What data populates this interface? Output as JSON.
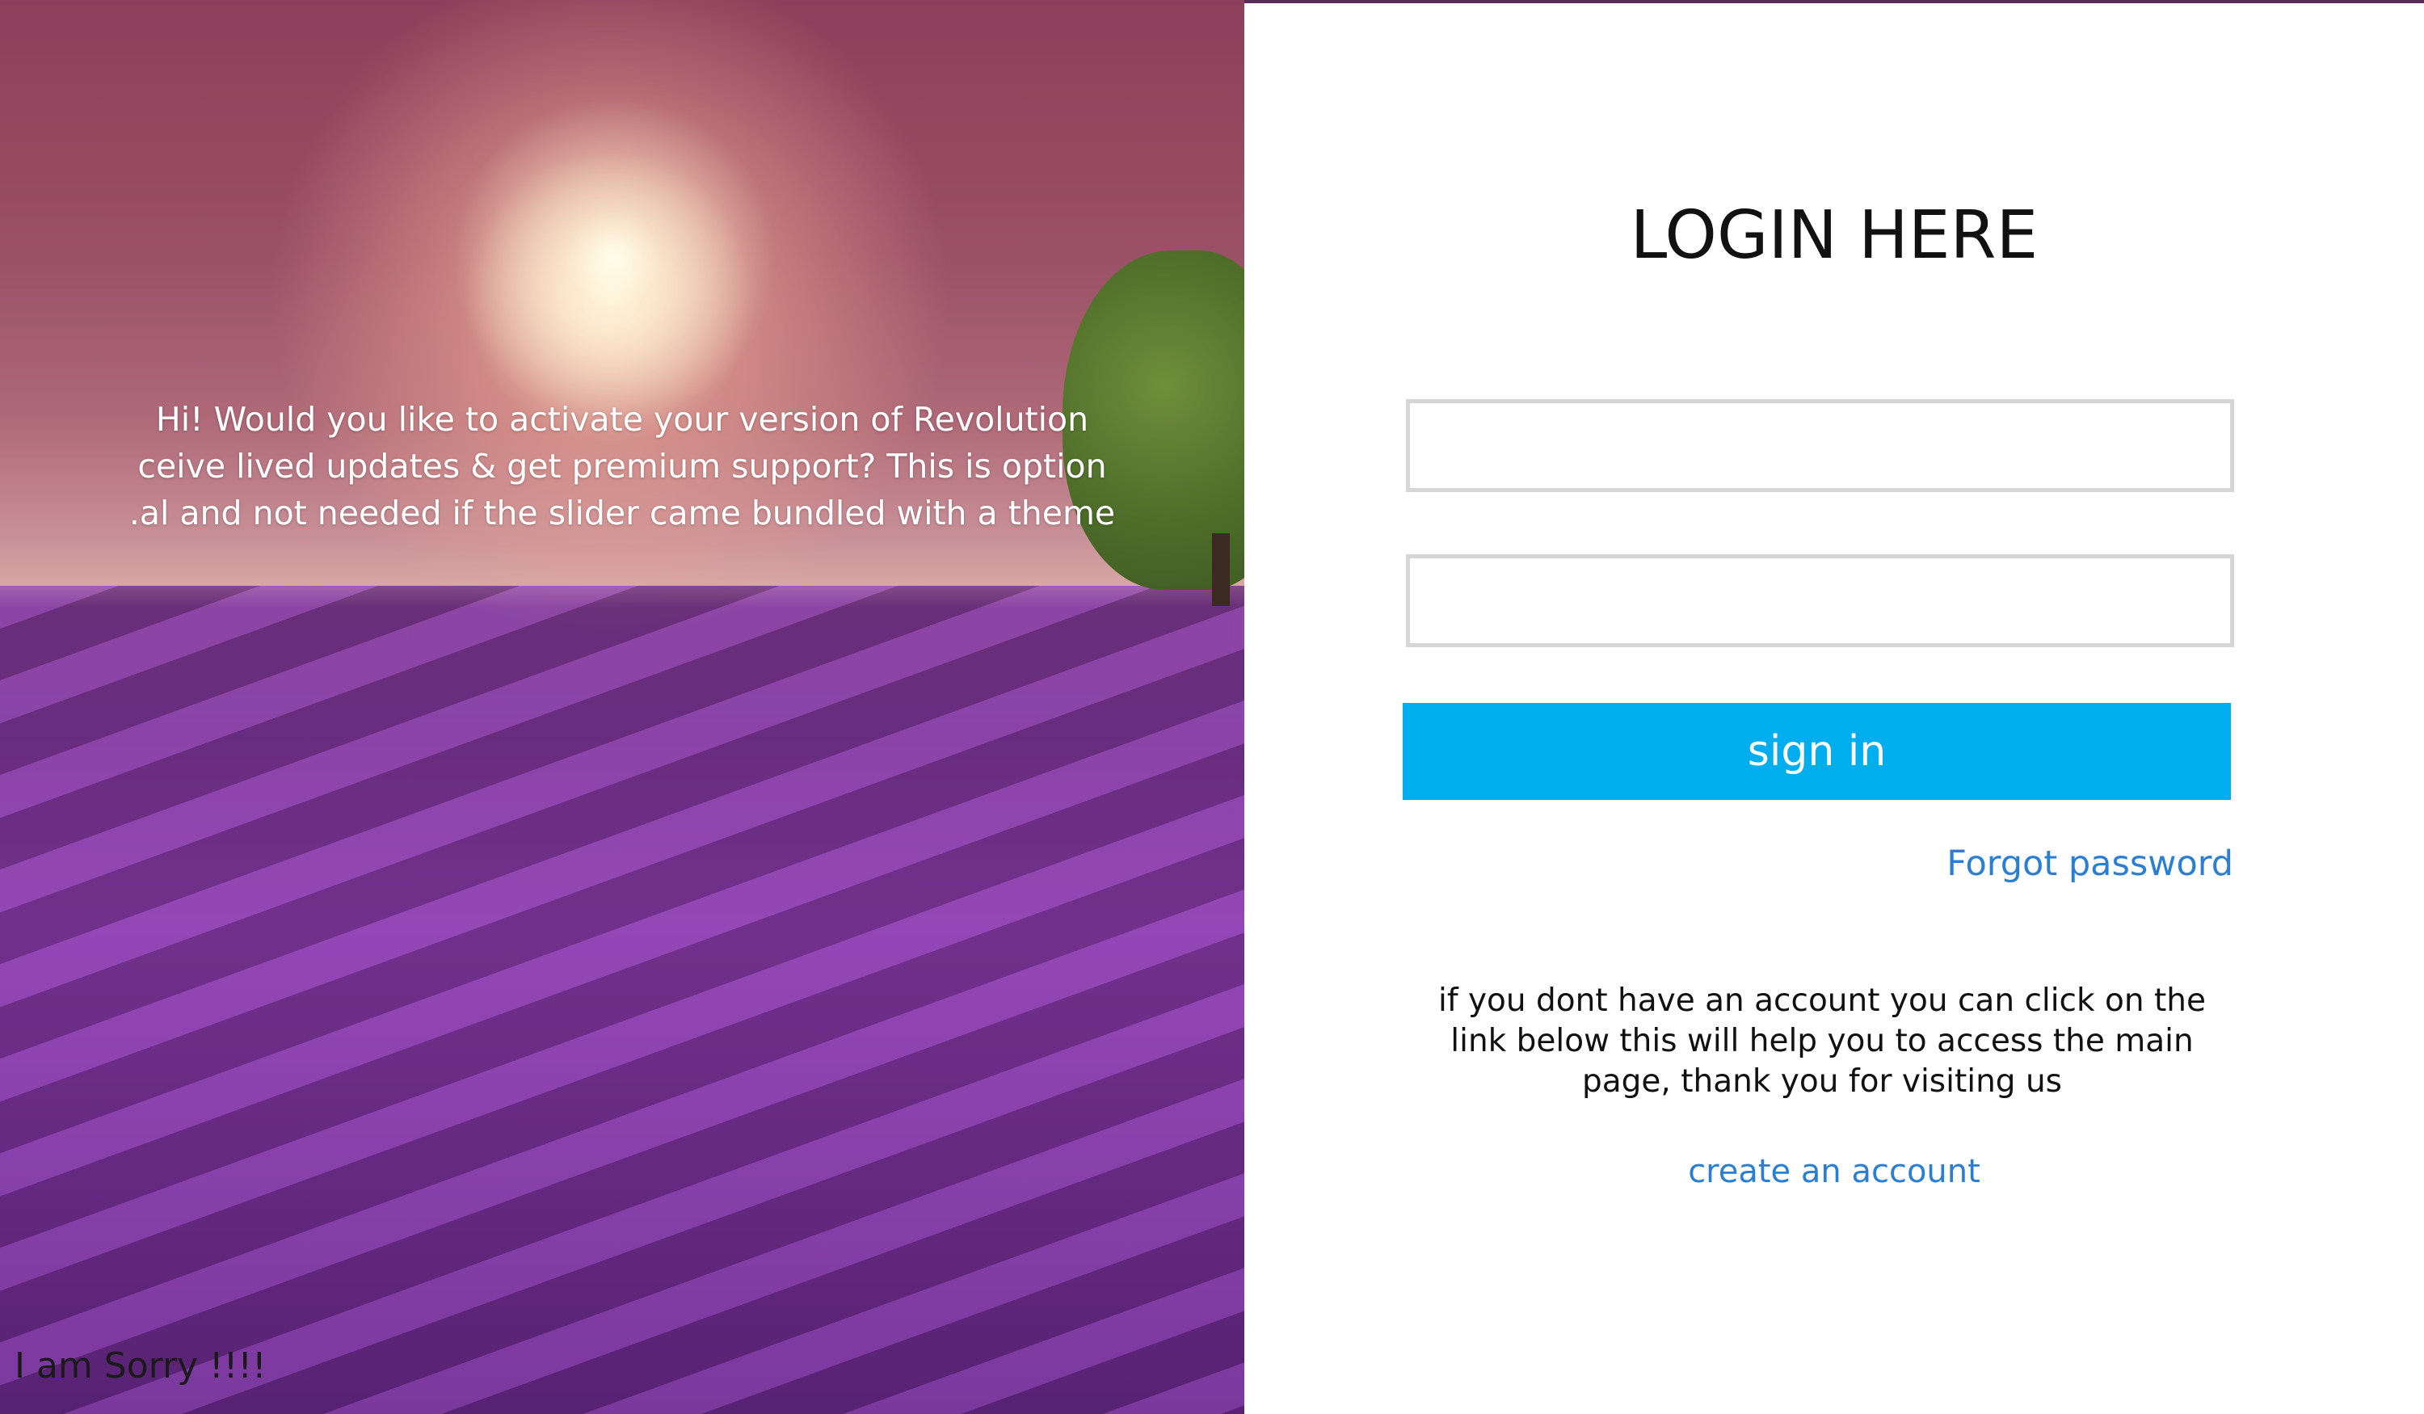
{
  "hero": {
    "message_lines": [
      "Hi! Would you like to activate your version of Revolution",
      "ceive lived updates & get premium support? This is option",
      ".al and not needed if the slider came bundled with a theme"
    ],
    "footnote": "I am Sorry !!!!"
  },
  "login": {
    "title": "LOGIN HERE",
    "username_value": "",
    "password_value": "",
    "signin_label": "sign in",
    "forgot_label": "Forgot password",
    "info_lines": [
      "if you dont have an account you can click on the",
      "link  below this will help you to access the main",
      "page, thank you for visiting us"
    ],
    "create_account_label": "create an account"
  },
  "colors": {
    "button": "#00aeef",
    "link": "#2a7fd4",
    "field_border": "#d6d6d6"
  }
}
